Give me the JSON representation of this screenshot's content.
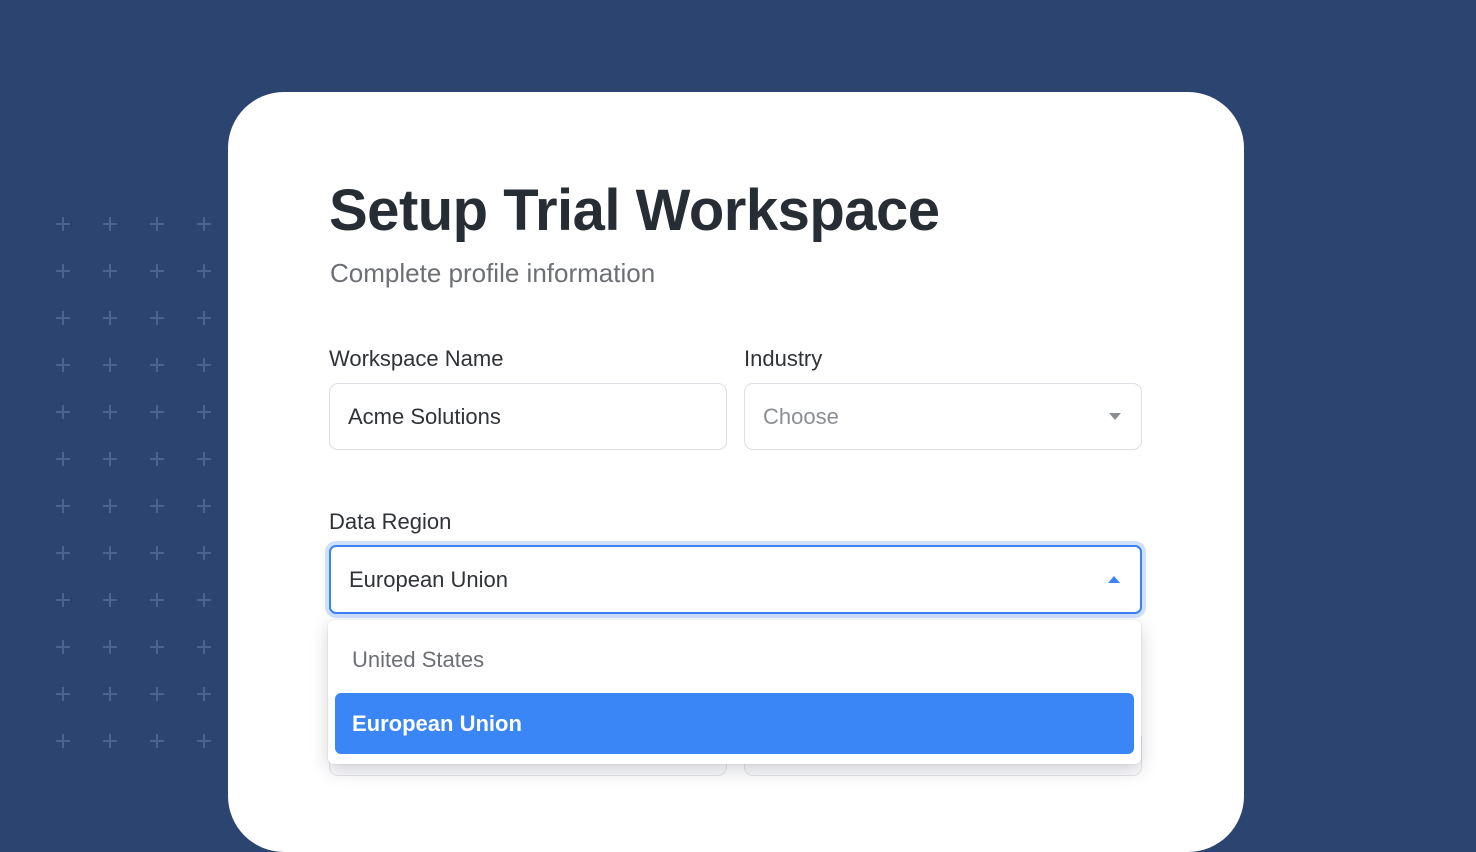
{
  "form": {
    "title": "Setup Trial Workspace",
    "subtitle": "Complete profile information",
    "workspace_name": {
      "label": "Workspace Name",
      "value": "Acme Solutions"
    },
    "industry": {
      "label": "Industry",
      "placeholder": "Choose"
    },
    "data_region": {
      "label": "Data Region",
      "value": "European Union",
      "expanded": true,
      "options": [
        "United States",
        "European Union"
      ],
      "selected_index": 1
    }
  },
  "colors": {
    "background": "#2c4570",
    "card": "#ffffff",
    "accent": "#3b86f7",
    "title_text": "#262d34",
    "muted_text": "#6c6f74"
  },
  "icons": {
    "industry_caret": "chevron-down-icon",
    "region_caret": "chevron-up-icon",
    "background_pattern": "plus-icon"
  }
}
